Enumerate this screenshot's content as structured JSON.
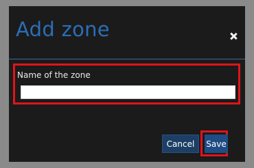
{
  "dialog": {
    "title": "Add zone",
    "close_icon": "close-icon",
    "field": {
      "label": "Name of the zone",
      "value": "",
      "placeholder": ""
    },
    "buttons": {
      "cancel_label": "Cancel",
      "save_label": "Save"
    }
  },
  "colors": {
    "title": "#2a6fb6",
    "dialog_background": "#1b1b1b",
    "highlight": "#e1141b",
    "button": "#1f4c84"
  }
}
